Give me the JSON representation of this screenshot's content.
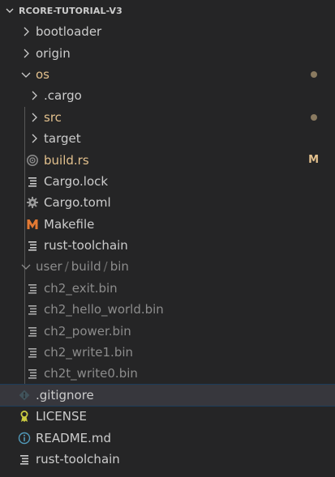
{
  "explorer": {
    "title": "RCORE-TUTORIAL-V3"
  },
  "tree": {
    "bootloader": "bootloader",
    "origin": "origin",
    "os": "os",
    "cargo_dir": ".cargo",
    "src": "src",
    "target": "target",
    "build_rs": "build.rs",
    "build_rs_status": "M",
    "cargo_lock": "Cargo.lock",
    "cargo_toml": "Cargo.toml",
    "makefile": "Makefile",
    "rust_toolchain_os": "rust-toolchain",
    "user_path": {
      "part1": "user",
      "sep1": "/",
      "part2": "build",
      "sep2": "/",
      "part3": "bin"
    },
    "ch2_exit": "ch2_exit.bin",
    "ch2_hello": "ch2_hello_world.bin",
    "ch2_power": "ch2_power.bin",
    "ch2_write1": "ch2_write1.bin",
    "ch2t_write0": "ch2t_write0.bin",
    "gitignore": ".gitignore",
    "license": "LICENSE",
    "readme": "README.md",
    "rust_toolchain_root": "rust-toolchain"
  },
  "colors": {
    "background": "#252526",
    "text": "#cccccc",
    "modified": "#e2c08d",
    "ignored": "#8c8c8c",
    "selected": "#37373d",
    "makefile_icon": "#e37933",
    "license_icon": "#cbcb41",
    "readme_icon": "#519aba"
  },
  "icons": {
    "chevron_down": "chevron-down-icon",
    "chevron_right": "chevron-right-icon",
    "rust": "rust-file-icon",
    "text_file": "text-file-icon",
    "gear": "gear-icon",
    "makefile": "makefile-icon",
    "git": "git-icon",
    "license": "license-icon",
    "info": "info-icon"
  }
}
